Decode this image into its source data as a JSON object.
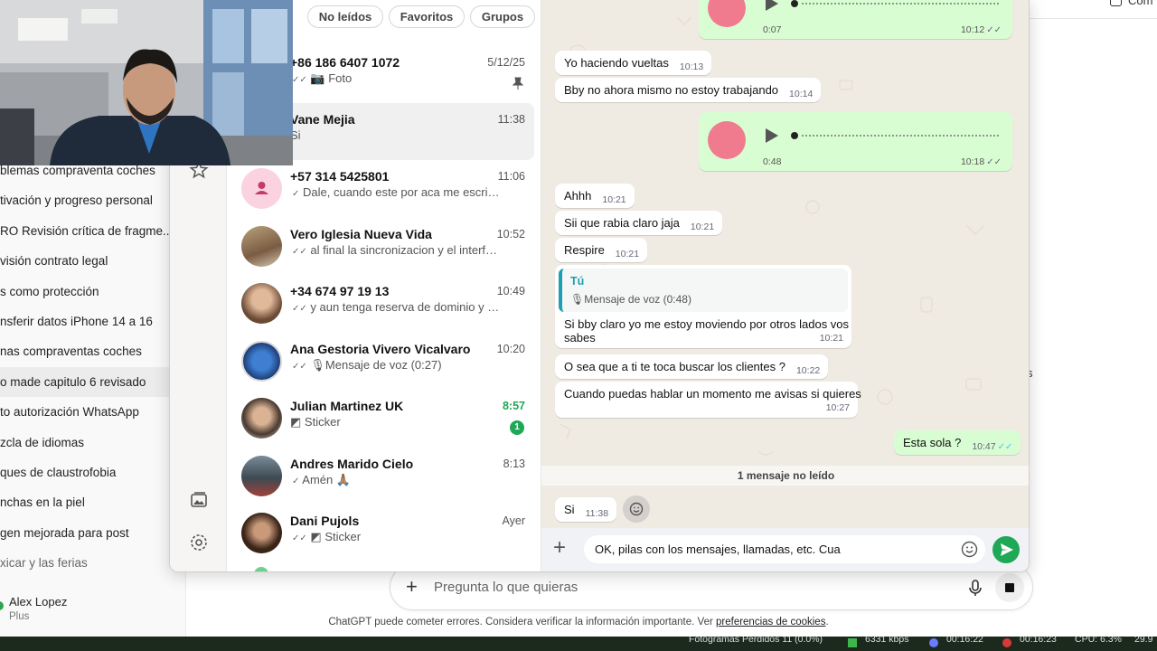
{
  "chatgpt": {
    "history": [
      "blemas compraventa coches",
      "tivación y progreso personal",
      "RO Revisión crítica de fragme...",
      "visión contrato legal",
      "s como protección",
      "nsferir datos iPhone 14 a 16",
      "nas compraventas coches",
      "o made capitulo 6 revisado",
      "to autorización WhatsApp",
      "zcla de idiomas",
      "ques de claustrofobia",
      "nchas en la piel",
      "gen mejorada para post",
      "xicar y las ferias"
    ],
    "user_name": "Alex Lopez",
    "user_plan": "Plus",
    "top_right_label": "Com",
    "side_char": "s",
    "composer_placeholder": "Pregunta lo que quieras",
    "disclaimer": "ChatGPT puede cometer errores. Considera verificar la información importante. Ver",
    "disclaimer_link": "preferencias de cookies",
    "disclaimer_end": "."
  },
  "taskbar": {
    "items": [
      "Fotogramas Perdidos 11 (0.0%)",
      "6331 kbps",
      "00:16:22",
      "00:16:23",
      "CPU: 6.3%",
      "29.9"
    ]
  },
  "whatsapp": {
    "filters": [
      "No leídos",
      "Favoritos",
      "Grupos"
    ],
    "chats": [
      {
        "name": "+86 186 6407 1072",
        "time": "5/12/25",
        "preview": "Foto",
        "ticks": "✓✓",
        "pinned": true
      },
      {
        "name": "Vane Mejia",
        "time": "11:38",
        "preview": "Si",
        "selected": true
      },
      {
        "name": "+57 314 5425801",
        "time": "11:06",
        "preview": "Dale, cuando este por aca me escribe...",
        "ticks": "✓"
      },
      {
        "name": "Vero Iglesia Nueva Vida",
        "time": "10:52",
        "preview": "al final la sincronizacion y el interface...",
        "ticks": "✓✓"
      },
      {
        "name": "+34 674 97 19 13",
        "time": "10:49",
        "preview": "y aun tenga reserva de dominio y no l...",
        "ticks": "✓✓"
      },
      {
        "name": "Ana Gestoria Vivero Vicalvaro",
        "time": "10:20",
        "preview": "Mensaje de voz (0:27)",
        "ticks": "✓✓"
      },
      {
        "name": "Julian Martinez UK",
        "time": "8:57",
        "preview": "Sticker",
        "unread": "1"
      },
      {
        "name": "Andres Marido Cielo",
        "time": "8:13",
        "preview": "Amén 🙏🏽",
        "ticks": "✓"
      },
      {
        "name": "Dani Pujols",
        "time": "Ayer",
        "preview": "Sticker",
        "ticks": "✓✓"
      }
    ],
    "messages": {
      "voice1": {
        "duration": "0:07",
        "time": "10:12"
      },
      "m1": {
        "text": "Yo haciendo vueltas",
        "time": "10:13"
      },
      "m2": {
        "text": "Bby no ahora mismo no estoy trabajando",
        "time": "10:14"
      },
      "voice2": {
        "duration": "0:48",
        "time": "10:18"
      },
      "m3": {
        "text": "Ahhh",
        "time": "10:21"
      },
      "m4": {
        "text": "Sii que rabia claro jaja",
        "time": "10:21"
      },
      "m5": {
        "text": "Respire",
        "time": "10:21"
      },
      "reply": {
        "quoted_author": "Tú",
        "quoted_text": "Mensaje de voz (0:48)",
        "text_line1": "Si bby claro yo me estoy moviendo por otros lados vos",
        "text_line2": "sabes",
        "time": "10:21"
      },
      "m6": {
        "text": "O sea que a ti te toca buscar los clientes ?",
        "time": "10:22"
      },
      "m7": {
        "text": "Cuando puedas hablar un momento me avisas si quieres",
        "time": "10:27"
      },
      "m8": {
        "text": "Esta sola ?",
        "time": "10:47"
      },
      "unread_label": "1 mensaje no leído",
      "m9": {
        "text": "Si",
        "time": "11:38"
      }
    },
    "composer_text": "OK, pilas con los mensajes, llamadas, etc. Cua",
    "colors": {
      "accent": "#1fa855",
      "outgoing": "#d9fdd3",
      "chat_bg": "#efeae2",
      "read_ticks": "#53bdeb"
    }
  }
}
